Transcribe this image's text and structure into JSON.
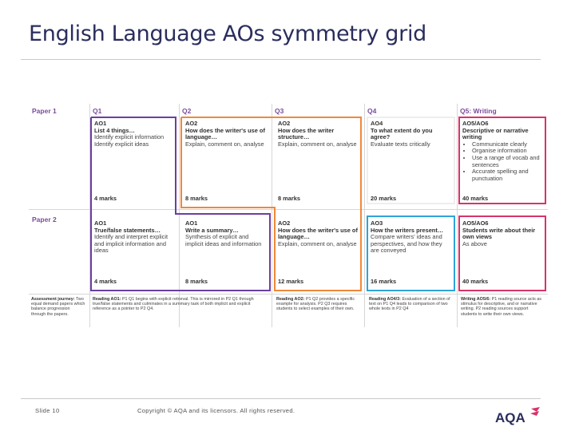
{
  "title": "English Language AOs symmetry grid",
  "columns": [
    "Q1",
    "Q2",
    "Q3",
    "Q4",
    "Q5: Writing"
  ],
  "rows": [
    "Paper 1",
    "Paper 2"
  ],
  "paper1": {
    "q1": {
      "ao": "AO1",
      "q": "List 4 things…",
      "desc": [
        "Identify explicit information",
        "Identify explicit ideas"
      ],
      "marks": "4 marks"
    },
    "q2": {
      "ao": "AO2",
      "q": "How does the writer's use of language…",
      "desc": [
        "Explain, comment on, analyse"
      ],
      "marks": "8 marks"
    },
    "q3": {
      "ao": "AO2",
      "q": "How does the writer structure…",
      "desc": [
        "Explain, comment on, analyse"
      ],
      "marks": "8 marks"
    },
    "q4": {
      "ao": "AO4",
      "q": "To what extent do you agree?",
      "desc": [
        "Evaluate texts critically"
      ],
      "marks": "20 marks"
    },
    "q5": {
      "ao": "AO5/AO6",
      "q": "Descriptive or narrative writing",
      "bullets": [
        "Communicate clearly",
        "Organise information",
        "Use a range of vocab and sentences",
        "Accurate spelling and punctuation"
      ],
      "marks": "40 marks"
    }
  },
  "paper2": {
    "q1": {
      "ao": "AO1",
      "q": "True/false statements…",
      "desc": [
        "Identify and interpret explicit and implicit information and ideas"
      ],
      "marks": "4 marks"
    },
    "q2": {
      "ao": "AO1",
      "q": "Write a summary…",
      "desc": [
        "Synthesis of explicit and implicit ideas and information"
      ],
      "marks": "8 marks"
    },
    "q3": {
      "ao": "AO2",
      "q": "How does the writer's use of language…",
      "desc": [
        "Explain, comment on, analyse"
      ],
      "marks": "12 marks"
    },
    "q4": {
      "ao": "AO3",
      "q": "How the writers present…",
      "desc": [
        "Compare writers' ideas and perspectives, and how they are conveyed"
      ],
      "marks": "16 marks"
    },
    "q5": {
      "ao": "AO5/AO6",
      "q": "Students write about their own views",
      "desc": [
        "As above"
      ],
      "marks": "40 marks"
    }
  },
  "journey": {
    "label": "Assessment journey:",
    "intro": "Two equal demand papers which balance progression through the papers.",
    "r1_head": "Reading AO1:",
    "r1": "P1 Q1 begins with explicit retrieval. This is mirrored in P2 Q1 through true/false statements and culminates in a summary task of both implicit and explicit reference as a pointer to P2 Q4.",
    "r2_head": "Reading AO2:",
    "r2": "P1 Q2 provides a specific example for analysis. P2 Q3 requires students to select examples of their own.",
    "r3_head": "Reading AO4/3:",
    "r3": "Evaluation of a section of text on P1 Q4 leads to comparison of two whole texts in P2 Q4",
    "r4_head": "Writing AO5/6:",
    "r4": "P1 reading source acts as stimulus for descriptive, and or narrative writing. P2 reading sources support students to write their own views."
  },
  "footer": {
    "slide": "Slide 10",
    "copyright": "Copyright © AQA and its licensors. All rights reserved.",
    "logo_text": "AQA"
  },
  "colors": {
    "title": "#2a2d5c",
    "purple": "#6b3fa0",
    "orange": "#f0883a",
    "teal": "#2ea4d8",
    "pink": "#d6336c"
  }
}
